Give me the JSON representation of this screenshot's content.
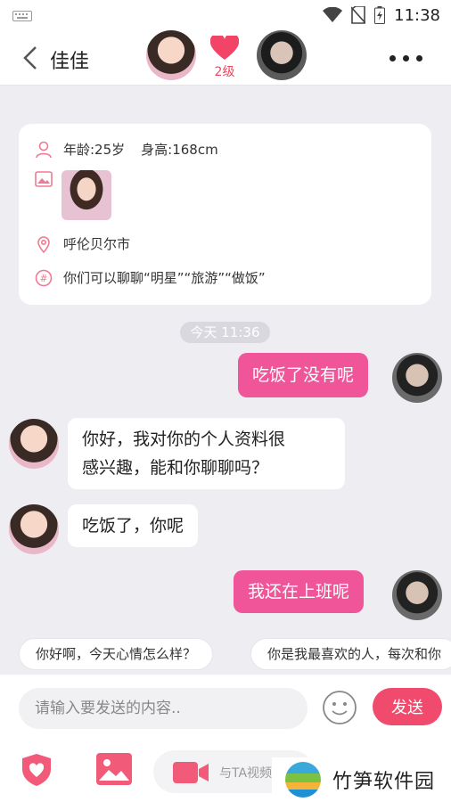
{
  "status_bar": {
    "time": "11:38"
  },
  "header": {
    "title": "佳佳",
    "level": "2级"
  },
  "profile": {
    "age": "年龄:25岁",
    "height": "身高:168cm",
    "city": "呼伦贝尔市",
    "topics": "你们可以聊聊“明星”“旅游”“做饭”"
  },
  "chat": {
    "timestamp": "今天 11:36",
    "messages": [
      {
        "from": "me",
        "text": "吃饭了没有呢"
      },
      {
        "from": "her",
        "line1": "你好，我对你的个人资料很",
        "line2": "感兴趣，能和你聊聊吗？"
      },
      {
        "from": "her",
        "text": "吃饭了，你呢"
      },
      {
        "from": "me",
        "text": "我还在上班呢"
      }
    ]
  },
  "quick_replies": [
    "你好啊，今天心情怎么样？",
    "你是我最喜欢的人，每次和你"
  ],
  "composer": {
    "placeholder": "请输入要发送的内容..",
    "send_label": "发送"
  },
  "toolbar": {
    "video_label": "与TA视频"
  },
  "watermark": {
    "text": "竹笋软件园"
  },
  "colors": {
    "accent_pink": "#f0559a",
    "send_red": "#f04a6c",
    "background": "#ededf2"
  },
  "icons": [
    "keyboard-icon",
    "wifi-icon",
    "no-sim-icon",
    "battery-icon",
    "back-icon",
    "heart-icon",
    "more-icon",
    "person-icon",
    "image-icon",
    "location-icon",
    "topic-icon",
    "emoji-icon",
    "shield-heart-icon",
    "gallery-icon",
    "video-camera-icon"
  ]
}
